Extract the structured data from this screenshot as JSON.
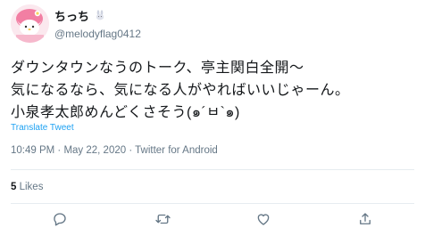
{
  "author": {
    "display_name": "ちっち",
    "name_emoji": "rabbit-face",
    "handle": "@melodyflag0412"
  },
  "tweet": {
    "lines": [
      "ダウンタウンなうのトーク、亭主関白全開～",
      "気になるなら、気になる人がやればいいじゃーん。",
      "小泉孝太郎めんどくさそう(๑´ㅂ`๑)"
    ],
    "translate_label": "Translate Tweet",
    "timestamp": "10:49 PM · May 22, 2020 · Twitter for Android"
  },
  "stats": {
    "likes_count": "5",
    "likes_label": "Likes"
  },
  "actions": [
    "reply-icon",
    "retweet-icon",
    "like-icon",
    "share-icon"
  ],
  "colors": {
    "link": "#1da1f2",
    "muted": "#657786",
    "text": "#14171a",
    "divider": "#e6ecf0"
  }
}
